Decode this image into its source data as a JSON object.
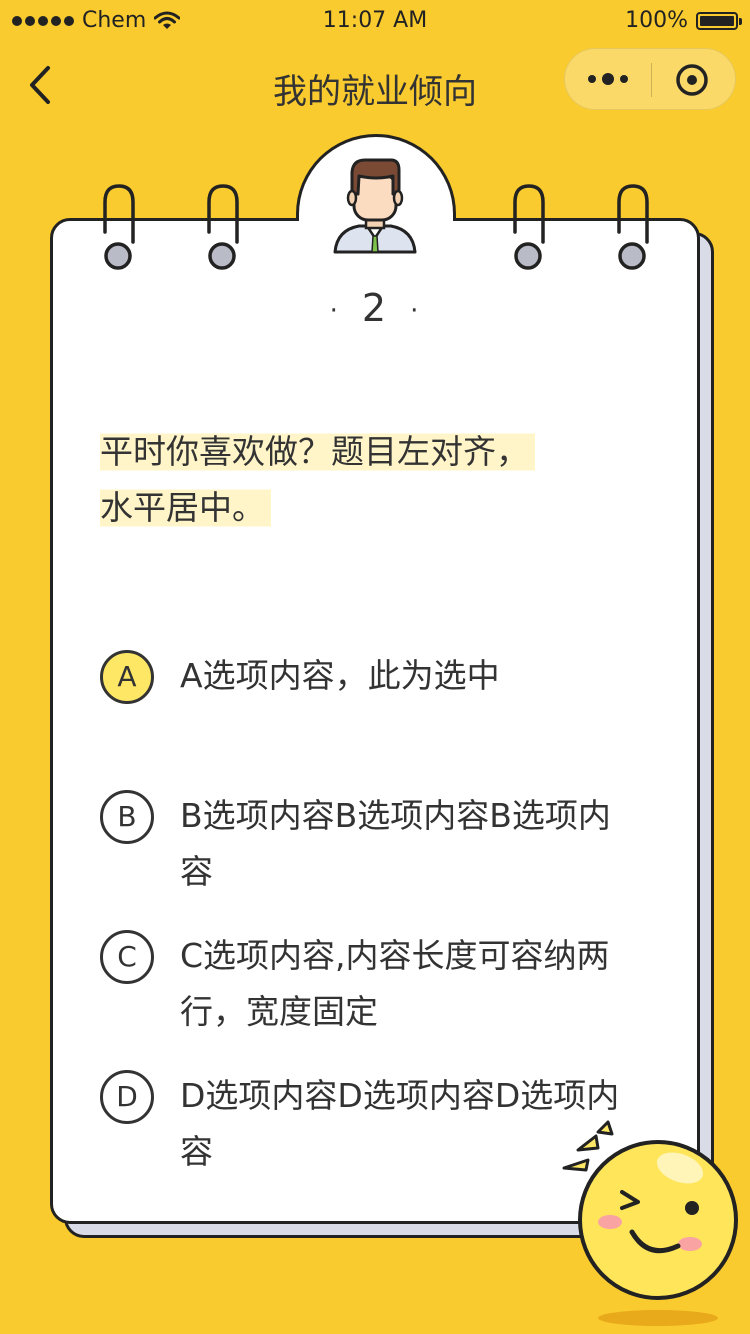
{
  "status_bar": {
    "carrier": "Chem",
    "time": "11:07 AM",
    "battery": "100%",
    "battery_level": 1.0
  },
  "nav": {
    "title": "我的就业倾向"
  },
  "colors": {
    "background": "#F9CB2E",
    "highlight": "#FFF5C9",
    "selected": "#FFE766",
    "card_shadow": "#D9DCE7"
  },
  "question": {
    "number": "2",
    "lines": [
      "平时你喜欢做？题目左对齐，",
      "水平居中。"
    ]
  },
  "options": [
    {
      "letter": "A",
      "text": "A选项内容，此为选中",
      "selected": true
    },
    {
      "letter": "B",
      "text": "B选项内容B选项内容B选项内容",
      "selected": false
    },
    {
      "letter": "C",
      "text": "C选项内容,内容长度可容纳两行，宽度固定",
      "selected": false
    },
    {
      "letter": "D",
      "text": "D选项内容D选项内容D选项内容",
      "selected": false
    }
  ],
  "icons": [
    "back-arrow-icon",
    "more-dots-icon",
    "target-close-icon",
    "avatar-icon",
    "smiley-icon",
    "wifi-icon",
    "battery-icon"
  ]
}
